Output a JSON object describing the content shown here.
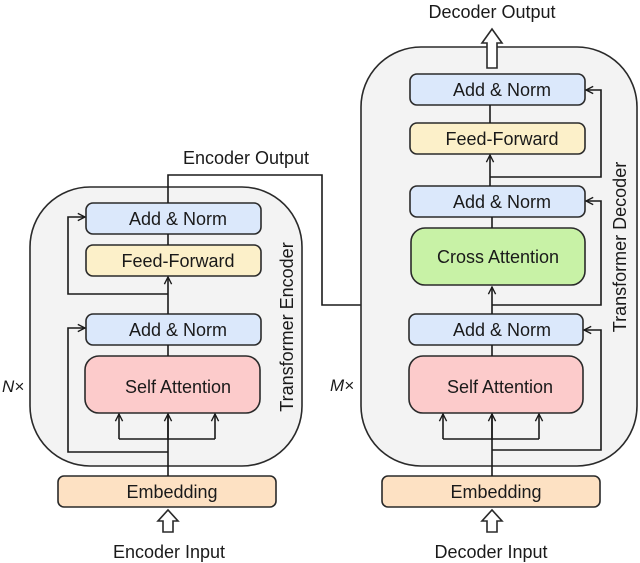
{
  "colors": {
    "add_norm": "#dbe8fb",
    "feed_forward": "#fcf0c9",
    "self_attention": "#fccbcb",
    "cross_attention": "#c8f2a6",
    "embedding": "#fde1c3",
    "container": "#f3f3f3"
  },
  "encoder": {
    "title": "Transformer Encoder",
    "repeat": "N×",
    "input_label": "Encoder Input",
    "output_label": "Encoder Output",
    "embedding": "Embedding",
    "self_attention": "Self Attention",
    "add_norm_1": "Add & Norm",
    "feed_forward": "Feed-Forward",
    "add_norm_2": "Add & Norm"
  },
  "decoder": {
    "title": "Transformer Decoder",
    "repeat": "M×",
    "input_label": "Decoder Input",
    "output_label": "Decoder Output",
    "embedding": "Embedding",
    "self_attention": "Self Attention",
    "add_norm_1": "Add & Norm",
    "cross_attention": "Cross Attention",
    "add_norm_2": "Add & Norm",
    "feed_forward": "Feed-Forward",
    "add_norm_3": "Add & Norm"
  }
}
